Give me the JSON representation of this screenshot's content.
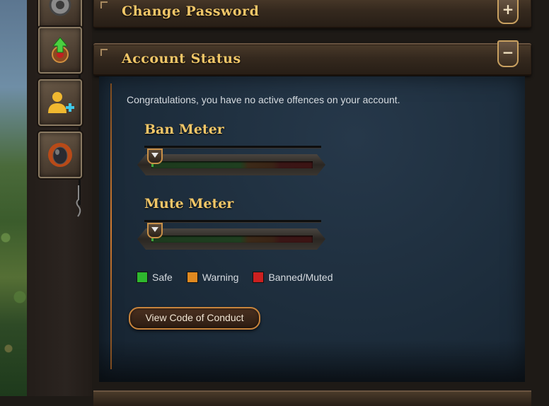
{
  "panels": {
    "change_password": {
      "title": "Change Password",
      "toggle": "+"
    },
    "account_status": {
      "title": "Account Status",
      "toggle": "−"
    }
  },
  "account_status": {
    "message": "Congratulations, you have no active offences on your account.",
    "ban_meter": {
      "title": "Ban Meter",
      "level": 0.0
    },
    "mute_meter": {
      "title": "Mute Meter",
      "level": 0.0
    },
    "legend": [
      {
        "label": "Safe",
        "color": "#2eb82e"
      },
      {
        "label": "Warning",
        "color": "#e08a20"
      },
      {
        "label": "Banned/Muted",
        "color": "#cc2020"
      }
    ],
    "conduct_button": "View Code of Conduct"
  },
  "sidebar": {
    "icons": [
      "gear-icon",
      "level-up-icon",
      "add-friend-icon",
      "bomb-icon"
    ]
  }
}
